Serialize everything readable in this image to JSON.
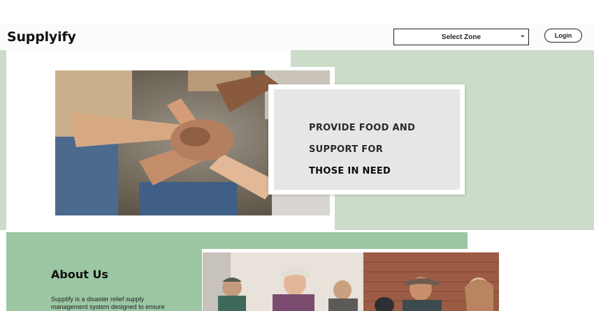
{
  "header": {
    "logo": "Supplyify",
    "zone_select": {
      "selected": "Select Zone"
    },
    "login_label": "Login"
  },
  "hero": {
    "lines": [
      "PROVIDE FOOD AND",
      "SUPPORT FOR",
      "THOSE IN NEED"
    ],
    "image_icon": "hands-together-photo"
  },
  "about": {
    "title": "About Us",
    "text_lines": [
      "Supplify is a disaster relief supply",
      "management system designed to ensure"
    ],
    "image_icon": "volunteers-photo"
  },
  "colors": {
    "sage": "#cbdcc8",
    "green": "#9cc7a3",
    "card_gray": "#e6e5e7"
  }
}
